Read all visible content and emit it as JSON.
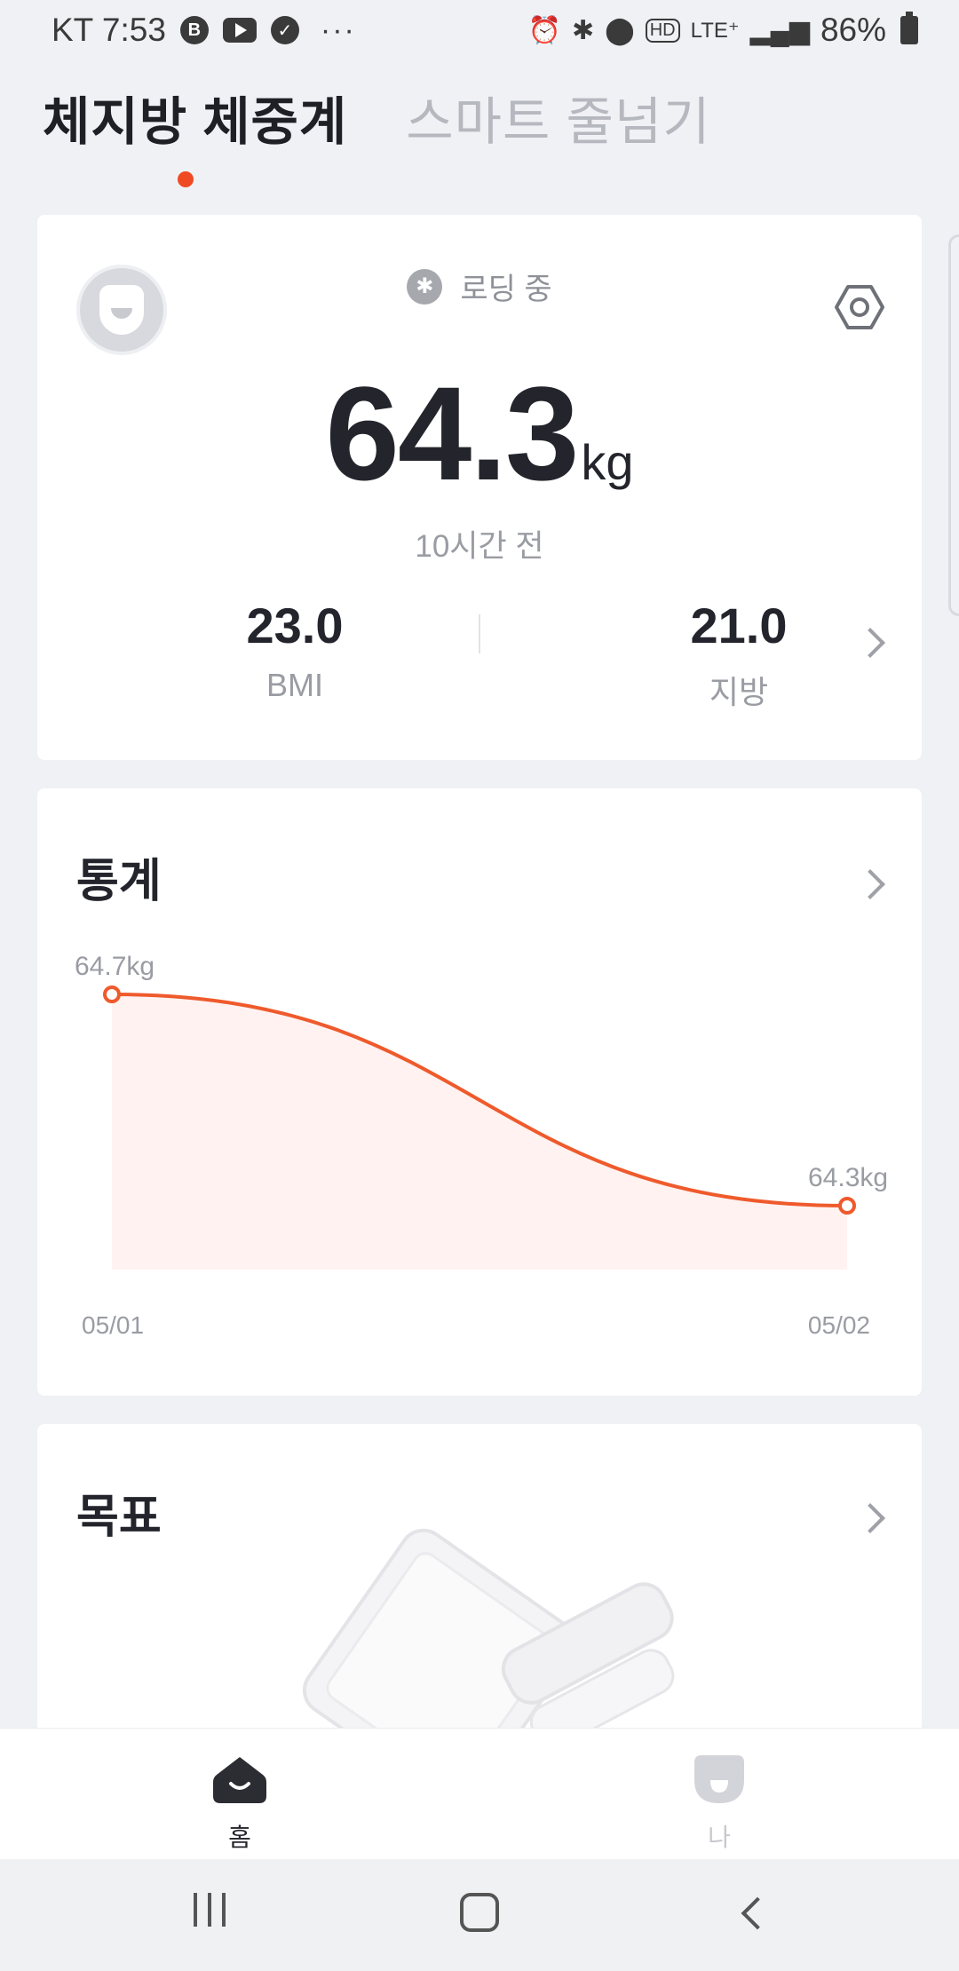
{
  "status_bar": {
    "carrier_time": "KT 7:53",
    "notification_icons": [
      "b-icon",
      "youtube-icon",
      "check-icon"
    ],
    "more": "···",
    "right_icons": [
      "alarm-icon",
      "bluetooth-icon",
      "location-icon",
      "hd-icon",
      "lte-icon",
      "signal-icon"
    ],
    "hd_label": "HD",
    "lte_label": "LTE⁺",
    "battery": "86%"
  },
  "tabs": {
    "active": "체지방 체중계",
    "inactive": "스마트 줄넘기"
  },
  "summary": {
    "connection_status": "로딩 중",
    "weight_value": "64.3",
    "weight_unit": "kg",
    "time_ago": "10시간 전",
    "bmi_value": "23.0",
    "bmi_label": "BMI",
    "fat_value": "21.0",
    "fat_label": "지방"
  },
  "stats": {
    "title": "통계"
  },
  "goal": {
    "title": "목표"
  },
  "bottom_nav": {
    "home_label": "홈",
    "me_label": "나"
  },
  "colors": {
    "accent": "#f04a24",
    "line": "#ef5a2c",
    "area": "#fff2f0"
  },
  "chart_data": {
    "type": "area",
    "x": [
      "05/01",
      "05/02"
    ],
    "series": [
      {
        "values": [
          64.7,
          64.3
        ]
      }
    ],
    "point_labels": [
      "64.7kg",
      "64.3kg"
    ],
    "title": "",
    "xlabel": "",
    "ylabel": ""
  }
}
